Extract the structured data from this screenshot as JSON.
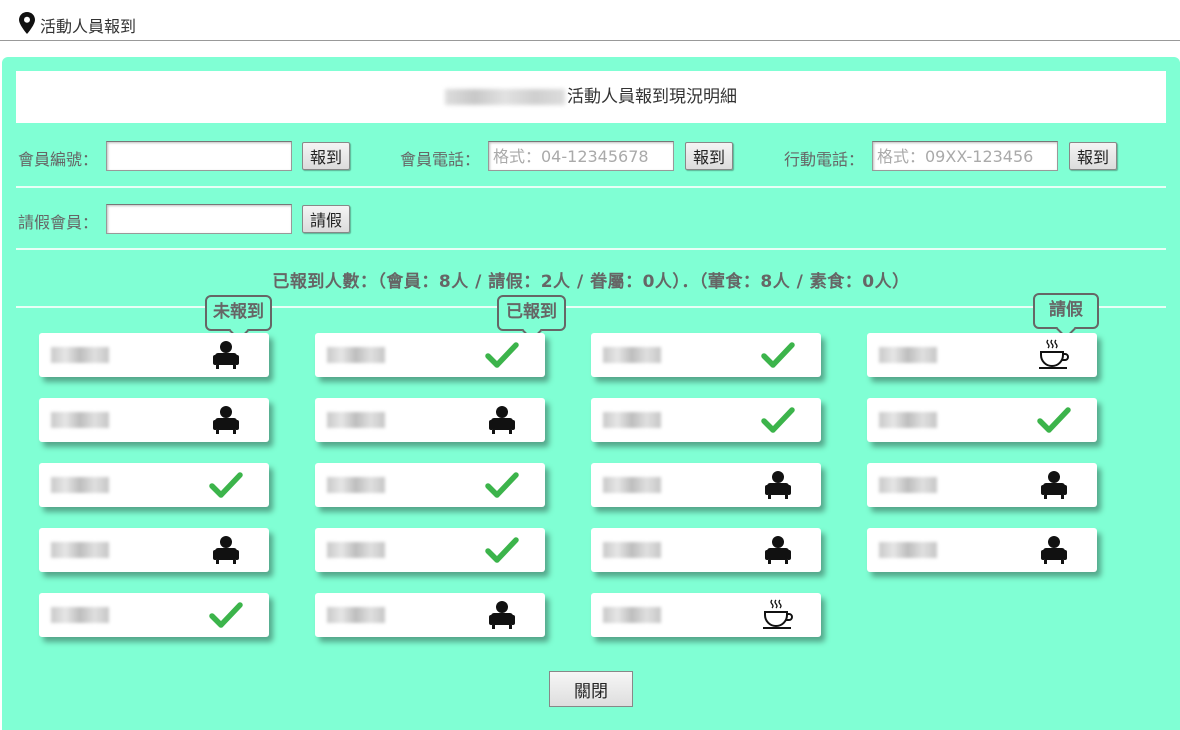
{
  "topbar": {
    "title": "活動人員報到",
    "icon": "map-pin-icon"
  },
  "header": {
    "title": "活動人員報到現況明細"
  },
  "checkin": {
    "member_no_label": "會員編號：",
    "member_no_value": "",
    "member_no_button": "報到",
    "phone_label": "會員電話：",
    "phone_placeholder": "格式：04-12345678",
    "phone_button": "報到",
    "mobile_label": "行動電話：",
    "mobile_placeholder": "格式：09XX-123456",
    "mobile_button": "報到"
  },
  "leave": {
    "label": "請假會員：",
    "value": "",
    "button": "請假"
  },
  "summary": "已報到人數：（會員：8人 / 請假：2人 / 眷屬：0人）．（葷食：8人 / 素食：0人）",
  "legend": {
    "not_checked_in": "未報到",
    "checked_in": "已報到",
    "on_leave": "請假"
  },
  "colors": {
    "panel_bg": "#80ffd4",
    "check": "#3cb44b"
  },
  "members": [
    {
      "status": "not_checked_in"
    },
    {
      "status": "checked_in"
    },
    {
      "status": "checked_in"
    },
    {
      "status": "on_leave"
    },
    {
      "status": "not_checked_in"
    },
    {
      "status": "not_checked_in"
    },
    {
      "status": "checked_in"
    },
    {
      "status": "checked_in"
    },
    {
      "status": "checked_in"
    },
    {
      "status": "checked_in"
    },
    {
      "status": "not_checked_in"
    },
    {
      "status": "not_checked_in"
    },
    {
      "status": "not_checked_in"
    },
    {
      "status": "checked_in"
    },
    {
      "status": "not_checked_in"
    },
    {
      "status": "not_checked_in"
    },
    {
      "status": "checked_in"
    },
    {
      "status": "not_checked_in"
    },
    {
      "status": "on_leave"
    }
  ],
  "close_button": "關閉"
}
